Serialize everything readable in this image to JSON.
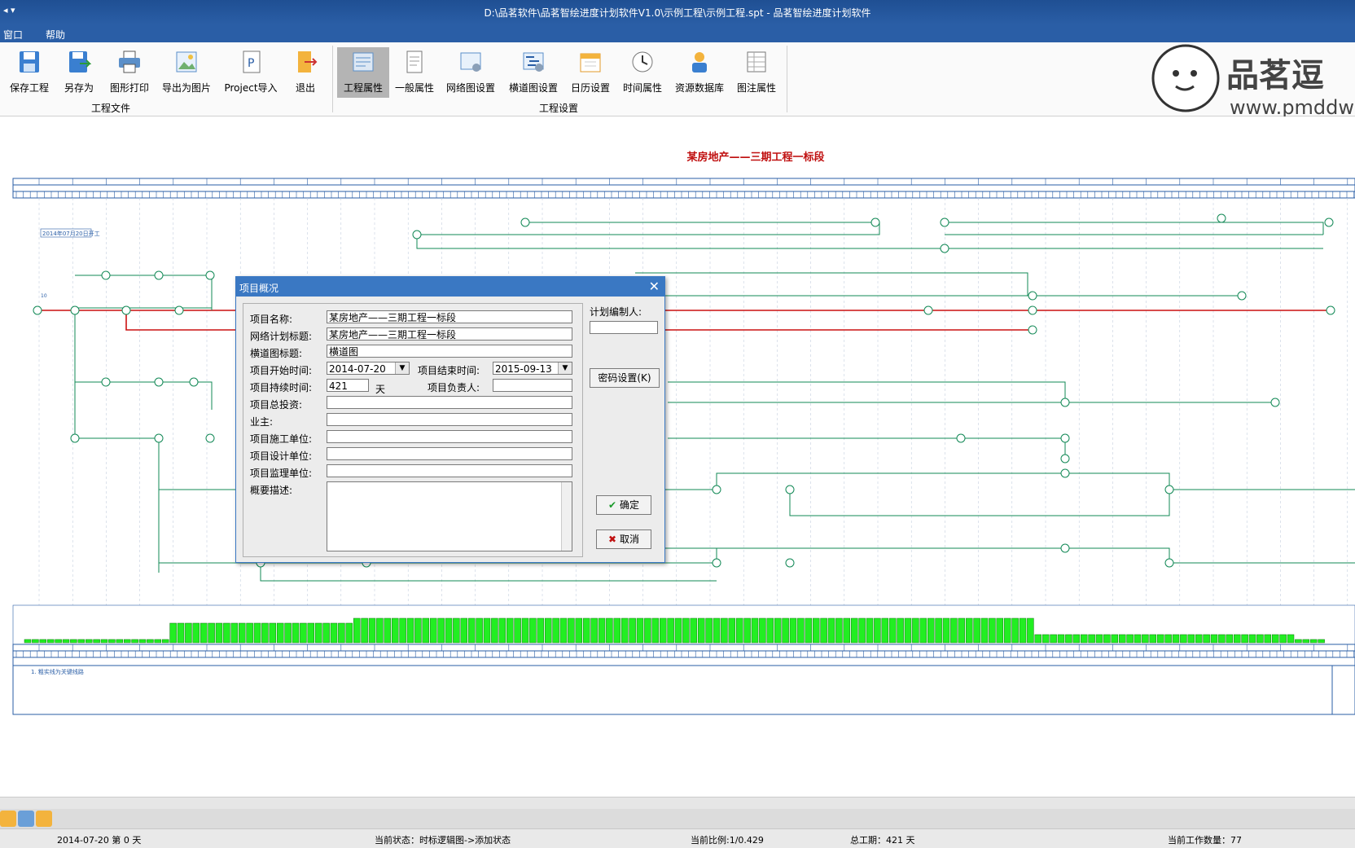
{
  "window": {
    "title": "D:\\品茗软件\\品茗智绘进度计划软件V1.0\\示例工程\\示例工程.spt - 品茗智绘进度计划软件"
  },
  "menu": {
    "items": [
      "窗口",
      "帮助"
    ]
  },
  "ribbon": {
    "file_group_label": "工程文件",
    "settings_group_label": "工程设置",
    "file_buttons": [
      "保存工程",
      "另存为",
      "图形打印",
      "导出为图片",
      "Project导入",
      "退出"
    ],
    "settings_buttons": [
      "工程属性",
      "一般属性",
      "网络图设置",
      "横道图设置",
      "日历设置",
      "时间属性",
      "资源数据库",
      "图注属性"
    ]
  },
  "logo": {
    "brand_text": "品茗逗",
    "url_text": "www.pmddw"
  },
  "chart": {
    "title": "某房地产——三期工程一标段",
    "start_note": "2014年07月20日开工",
    "note": "1. 粗实线为关键线路"
  },
  "dialog": {
    "title": "项目概况",
    "labels": {
      "project_name": "项目名称:",
      "network_title": "网络计划标题:",
      "bar_title": "横道图标题:",
      "start_time": "项目开始时间:",
      "end_time": "项目结束时间:",
      "duration": "项目持续时间:",
      "duration_unit": "天",
      "manager": "项目负责人:",
      "investment": "项目总投资:",
      "owner": "业主:",
      "construction_unit": "项目施工单位:",
      "design_unit": "项目设计单位:",
      "supervision_unit": "项目监理单位:",
      "description": "概要描述:",
      "planner": "计划编制人:"
    },
    "values": {
      "project_name": "某房地产——三期工程一标段",
      "network_title": "某房地产——三期工程一标段",
      "bar_title": "横道图",
      "start_time": "2014-07-20",
      "end_time": "2015-09-13",
      "duration": "421"
    },
    "buttons": {
      "password": "密码设置(K)",
      "ok": "确定",
      "cancel": "取消"
    }
  },
  "status": {
    "date": "2014-07-20 第 0 天",
    "state": "当前状态：时标逻辑图->添加状态",
    "scale": "当前比例:1/0.429",
    "total": "总工期：421 天",
    "count": "当前工作数量：77"
  },
  "colors": {
    "title_bar": "#2a5ea6",
    "critical_path": "#cc1111",
    "normal_path": "#118855",
    "resource_bar": "#22ee22"
  }
}
